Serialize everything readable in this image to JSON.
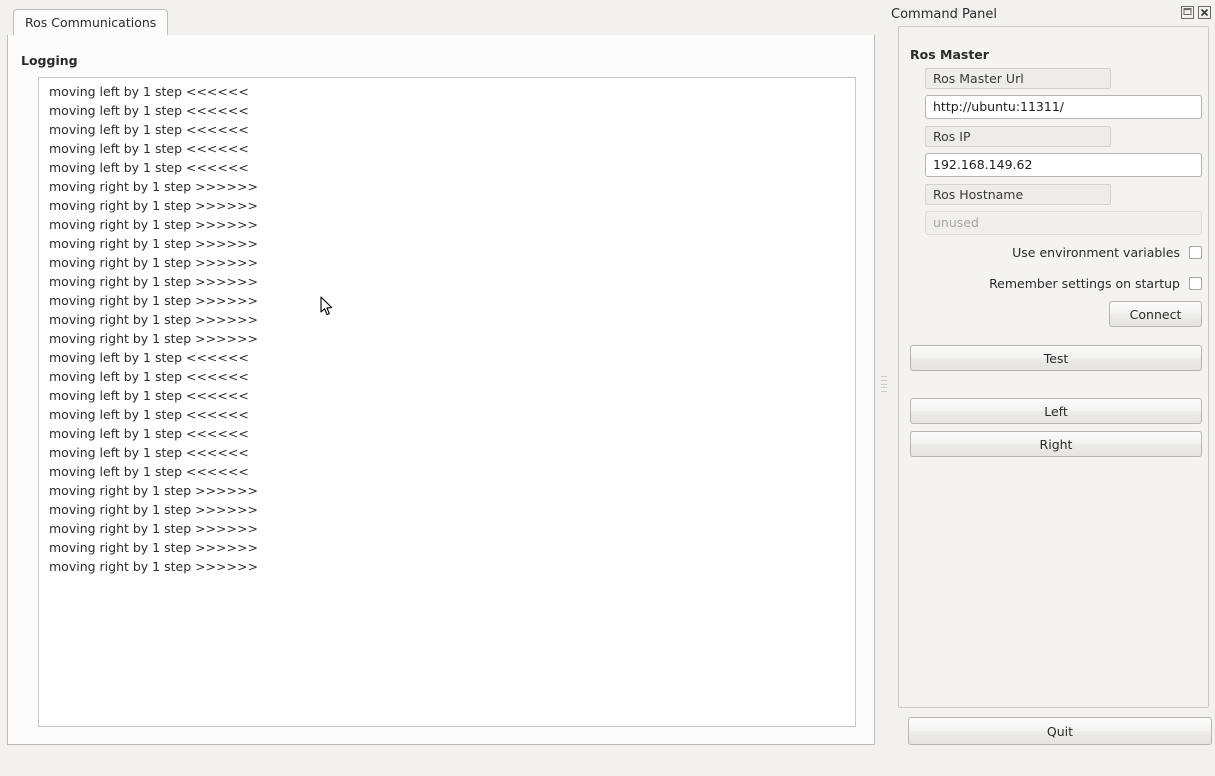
{
  "window": {
    "background": "#f2f1f0"
  },
  "tabs": {
    "items": [
      {
        "label": "Ros Communications",
        "active": true
      }
    ]
  },
  "logging": {
    "group_label": "Logging",
    "lines": [
      "moving left by 1 step <<<<<<",
      "moving left by 1 step <<<<<<",
      "moving left by 1 step <<<<<<",
      "moving left by 1 step <<<<<<",
      "moving left by 1 step <<<<<<",
      "moving right by 1 step >>>>>>",
      "moving right by 1 step >>>>>>",
      "moving right by 1 step >>>>>>",
      "moving right by 1 step >>>>>>",
      "moving right by 1 step >>>>>>",
      "moving right by 1 step >>>>>>",
      "moving right by 1 step >>>>>>",
      "moving right by 1 step >>>>>>",
      "moving right by 1 step >>>>>>",
      "moving left by 1 step <<<<<<",
      "moving left by 1 step <<<<<<",
      "moving left by 1 step <<<<<<",
      "moving left by 1 step <<<<<<",
      "moving left by 1 step <<<<<<",
      "moving left by 1 step <<<<<<",
      "moving left by 1 step <<<<<<",
      "moving right by 1 step >>>>>>",
      "moving right by 1 step >>>>>>",
      "moving right by 1 step >>>>>>",
      "moving right by 1 step >>>>>>",
      "moving right by 1 step >>>>>>"
    ]
  },
  "command_panel": {
    "title": "Command Panel",
    "float_icon": "float-restore-icon",
    "close_icon": "close-icon",
    "ros_master": {
      "group_label": "Ros Master",
      "fields": [
        {
          "label": "Ros Master Url",
          "value": "http://ubuntu:11311/",
          "placeholder": "",
          "disabled": false
        },
        {
          "label": "Ros IP",
          "value": "192.168.149.62",
          "placeholder": "",
          "disabled": false
        },
        {
          "label": "Ros Hostname",
          "value": "",
          "placeholder": "unused",
          "disabled": true
        }
      ],
      "checkboxes": [
        {
          "label": "Use environment variables",
          "checked": false
        },
        {
          "label": "Remember settings on startup",
          "checked": false
        }
      ],
      "connect_label": "Connect"
    },
    "test_label": "Test",
    "left_label": "Left",
    "right_label": "Right"
  },
  "footer": {
    "quit_label": "Quit"
  }
}
